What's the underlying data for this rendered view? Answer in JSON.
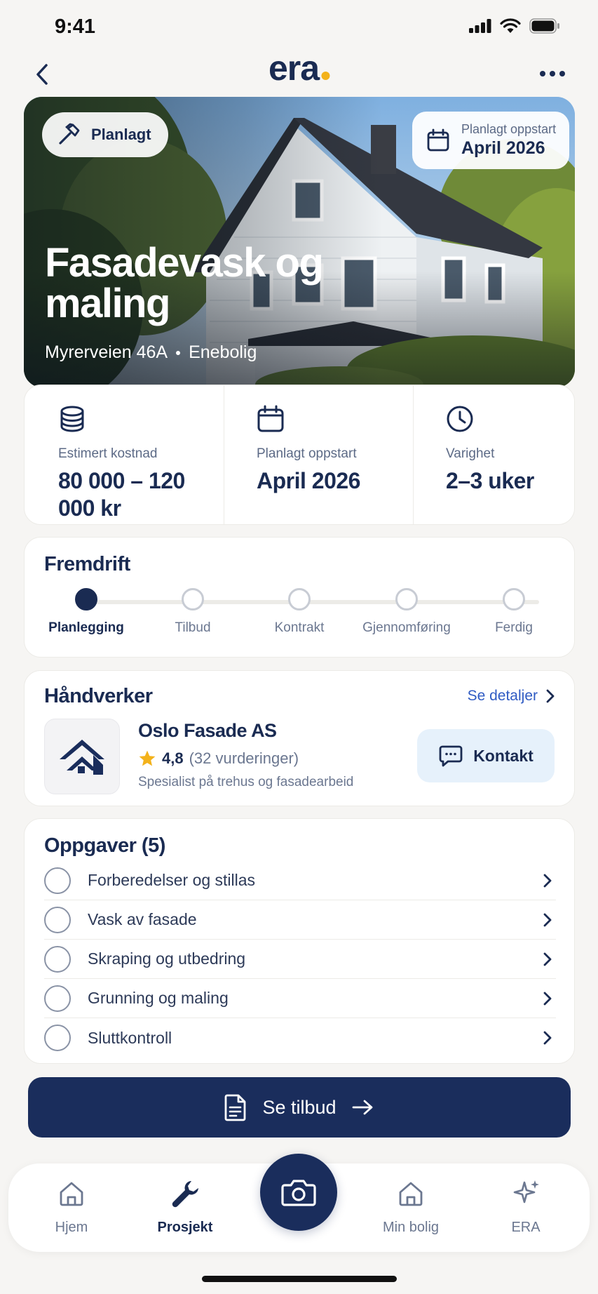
{
  "status_bar": {
    "time": "9:41"
  },
  "header": {
    "logo": "era"
  },
  "hero": {
    "status": "Planlagt",
    "start_label": "Planlagt oppstart",
    "start_value": "April 2026",
    "title": "Fasadevask og maling",
    "address": "Myrerveien 46A",
    "property_type": "Enebolig"
  },
  "stats": [
    {
      "label": "Estimert kostnad",
      "value": "80 000 – 120 000 kr",
      "icon": "coins-icon"
    },
    {
      "label": "Planlagt oppstart",
      "value": "April 2026",
      "icon": "calendar-icon"
    },
    {
      "label": "Varighet",
      "value": "2–3 uker",
      "icon": "clock-icon"
    }
  ],
  "progress": {
    "title": "Fremdrift",
    "current_step": 1,
    "steps": [
      "Planlegging",
      "Tilbud",
      "Kontrakt",
      "Gjennomføring",
      "Ferdig"
    ]
  },
  "craftsman": {
    "title": "Håndverker",
    "see_details": "Se detaljer",
    "company": "Oslo Fasade AS",
    "rating": "4,8",
    "rating_count": "(32 vurderinger)",
    "description": "Spesialist på trehus og fasadearbeid",
    "contact": "Kontakt"
  },
  "tasks": {
    "title": "Oppgaver (5)",
    "items": [
      "Forberedelser og stillas",
      "Vask av fasade",
      "Skraping og utbedring",
      "Grunning og maling",
      "Sluttkontroll"
    ]
  },
  "cta": {
    "label": "Se tilbud"
  },
  "bottom_nav": {
    "items": [
      {
        "label": "Hjem",
        "icon": "home-icon",
        "active": false
      },
      {
        "label": "Prosjekt",
        "icon": "wrench-icon",
        "active": true
      },
      {
        "label": "Min bolig",
        "icon": "house-icon",
        "active": false
      },
      {
        "label": "ERA",
        "icon": "sparkle-icon",
        "active": false
      }
    ],
    "center_icon": "camera-icon"
  },
  "colors": {
    "navy": "#1a2d5c",
    "accent_yellow": "#f3b21b",
    "link_blue": "#2f5bc3",
    "contact_bg": "#e6f1fb"
  }
}
